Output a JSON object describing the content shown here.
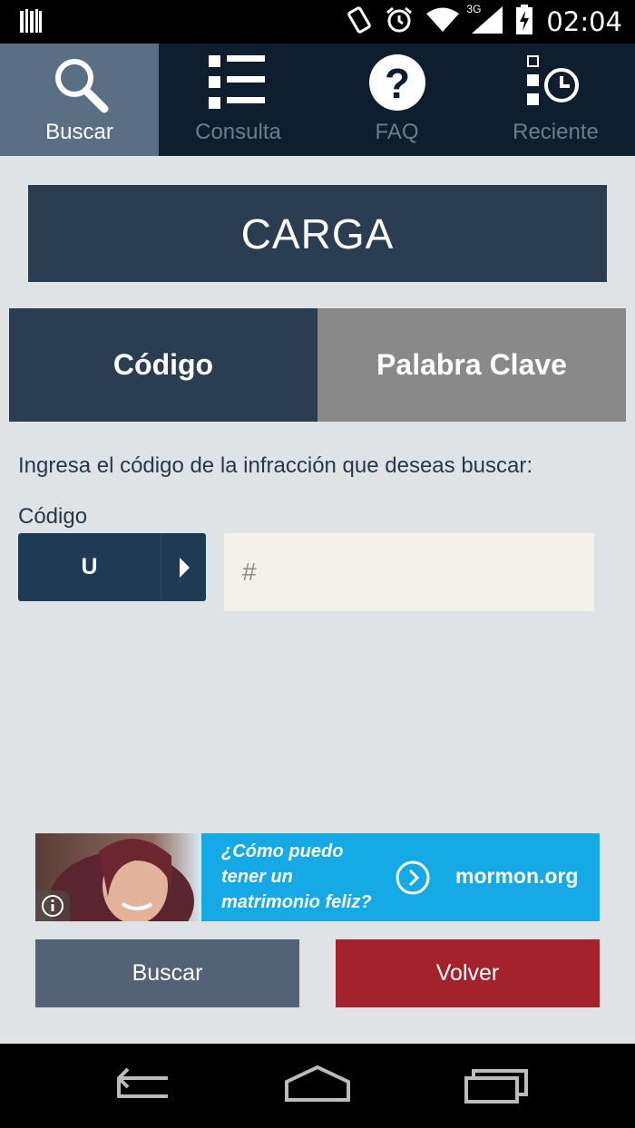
{
  "status_bar": {
    "time": "02:04",
    "network": "3G",
    "icons": [
      "barcode-icon",
      "vibrate-icon",
      "alarm-icon",
      "wifi-icon",
      "signal-icon",
      "battery-charging-icon"
    ]
  },
  "tabs": [
    {
      "label": "Buscar",
      "icon": "search-icon",
      "active": true
    },
    {
      "label": "Consulta",
      "icon": "list-icon",
      "active": false
    },
    {
      "label": "FAQ",
      "icon": "help-icon",
      "active": false
    },
    {
      "label": "Reciente",
      "icon": "recent-icon",
      "active": false
    }
  ],
  "title": "CARGA",
  "segments": {
    "codigo": "Código",
    "palabra_clave": "Palabra Clave",
    "selected": "codigo"
  },
  "instruction": "Ingresa el código de la infracción que deseas buscar:",
  "code_label": "Código",
  "code_select": {
    "value": "U"
  },
  "code_input": {
    "value": "",
    "placeholder": "#"
  },
  "ad": {
    "text_line1": "¿Cómo puedo",
    "text_line2": "tener un",
    "text_line3": "matrimonio feliz?",
    "site": "mormon.org"
  },
  "buttons": {
    "buscar": "Buscar",
    "volver": "Volver"
  },
  "colors": {
    "nav_bg": "#0f1e2e",
    "active_tab": "#5b6f84",
    "title_bg": "#2b3e51",
    "segment_inactive": "#898989",
    "buscar_button": "#536274",
    "volver_button": "#a3222b",
    "ad_bg": "#15a9e6"
  }
}
